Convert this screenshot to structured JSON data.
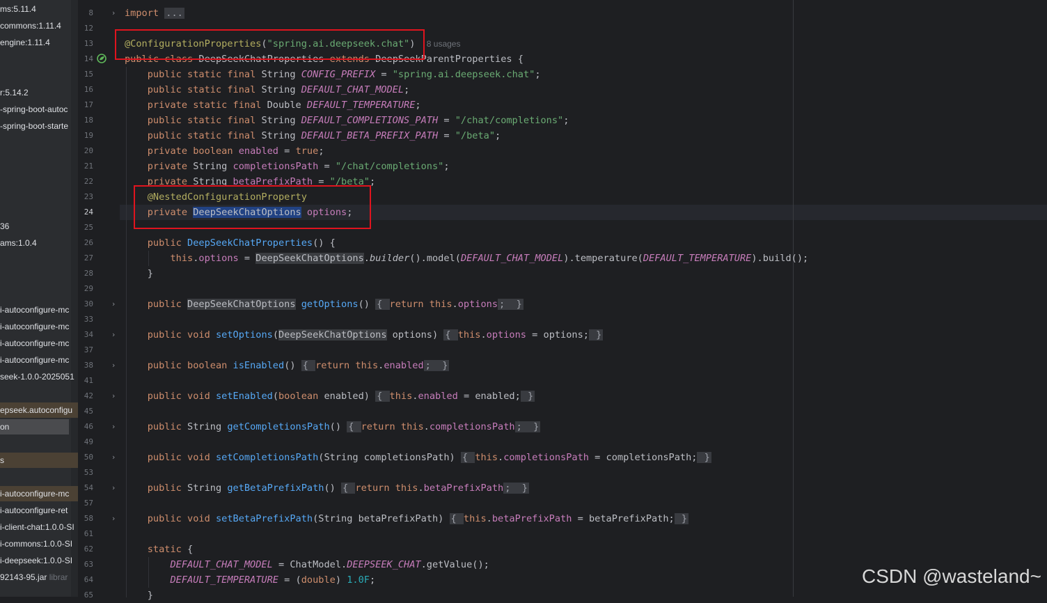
{
  "sidebar": {
    "items": [
      {
        "text": "ms:5.11.4"
      },
      {
        "text": "commons:1.11.4"
      },
      {
        "text": "engine:1.11.4"
      },
      {
        "text": "r:5.14.2"
      },
      {
        "text": "-spring-boot-autoc"
      },
      {
        "text": "-spring-boot-starte"
      },
      {
        "text": "36"
      },
      {
        "text": "ams:1.0.4"
      },
      {
        "text": "i-autoconfigure-mc"
      },
      {
        "text": "i-autoconfigure-mc"
      },
      {
        "text": "i-autoconfigure-mc"
      },
      {
        "text": "i-autoconfigure-mc"
      },
      {
        "text": "seek-1.0.0-2025051"
      },
      {
        "text": "epseek.autoconfigu"
      },
      {
        "text": "on"
      },
      {
        "text": "s"
      },
      {
        "text": "i-autoconfigure-mc"
      },
      {
        "text": "i-autoconfigure-ret"
      },
      {
        "text": "i-client-chat:1.0.0-SI"
      },
      {
        "text": "i-commons:1.0.0-SI"
      },
      {
        "text": "i-deepseek:1.0.0-SI"
      },
      {
        "text": "92143-95.jar",
        "dim": "librar"
      }
    ]
  },
  "editor": {
    "lines": [
      {
        "num": "8",
        "tokens": [
          [
            "kw",
            "import "
          ],
          [
            "fold-box",
            "..."
          ]
        ]
      },
      {
        "num": "12",
        "tokens": []
      },
      {
        "num": "13",
        "tokens": [
          [
            "ann",
            "@ConfigurationProperties"
          ],
          [
            "",
            "("
          ],
          [
            "str",
            "\"spring.ai.deepseek.chat\""
          ],
          [
            "",
            ")  "
          ],
          [
            "hint",
            "8 usages"
          ]
        ]
      },
      {
        "num": "14",
        "tokens": [
          [
            "kw",
            "public class "
          ],
          [
            "",
            "DeepSeekChatProperties "
          ],
          [
            "kw",
            "extends "
          ],
          [
            "",
            "DeepSeekParentProperties {"
          ]
        ]
      },
      {
        "num": "15",
        "tokens": [
          [
            "",
            "    "
          ],
          [
            "kw",
            "public static final "
          ],
          [
            "",
            "String "
          ],
          [
            "cst",
            "CONFIG_PREFIX"
          ],
          [
            "",
            " = "
          ],
          [
            "str",
            "\"spring.ai.deepseek.chat\""
          ],
          [
            "",
            ";"
          ]
        ]
      },
      {
        "num": "16",
        "tokens": [
          [
            "",
            "    "
          ],
          [
            "kw",
            "public static final "
          ],
          [
            "",
            "String "
          ],
          [
            "cst",
            "DEFAULT_CHAT_MODEL"
          ],
          [
            "",
            ";"
          ]
        ]
      },
      {
        "num": "17",
        "tokens": [
          [
            "",
            "    "
          ],
          [
            "kw",
            "private static final "
          ],
          [
            "",
            "Double "
          ],
          [
            "cst",
            "DEFAULT_TEMPERATURE"
          ],
          [
            "",
            ";"
          ]
        ]
      },
      {
        "num": "18",
        "tokens": [
          [
            "",
            "    "
          ],
          [
            "kw",
            "public static final "
          ],
          [
            "",
            "String "
          ],
          [
            "cst",
            "DEFAULT_COMPLETIONS_PATH"
          ],
          [
            "",
            " = "
          ],
          [
            "str",
            "\"/chat/completions\""
          ],
          [
            "",
            ";"
          ]
        ]
      },
      {
        "num": "19",
        "tokens": [
          [
            "",
            "    "
          ],
          [
            "kw",
            "public static final "
          ],
          [
            "",
            "String "
          ],
          [
            "cst",
            "DEFAULT_BETA_PREFIX_PATH"
          ],
          [
            "",
            " = "
          ],
          [
            "str",
            "\"/beta\""
          ],
          [
            "",
            ";"
          ]
        ]
      },
      {
        "num": "20",
        "tokens": [
          [
            "",
            "    "
          ],
          [
            "kw",
            "private boolean "
          ],
          [
            "fld",
            "enabled"
          ],
          [
            "",
            " = "
          ],
          [
            "kw",
            "true"
          ],
          [
            "",
            ";"
          ]
        ]
      },
      {
        "num": "21",
        "tokens": [
          [
            "",
            "    "
          ],
          [
            "kw",
            "private "
          ],
          [
            "",
            "String "
          ],
          [
            "fld",
            "completionsPath"
          ],
          [
            "",
            " = "
          ],
          [
            "str",
            "\"/chat/completions\""
          ],
          [
            "",
            ";"
          ]
        ]
      },
      {
        "num": "22",
        "tokens": [
          [
            "",
            "    "
          ],
          [
            "kw",
            "private "
          ],
          [
            "",
            "String "
          ],
          [
            "fld",
            "betaPrefixPath"
          ],
          [
            "",
            " = "
          ],
          [
            "str",
            "\"/beta\""
          ],
          [
            "",
            ";"
          ]
        ]
      },
      {
        "num": "23",
        "tokens": [
          [
            "",
            "    "
          ],
          [
            "ann",
            "@NestedConfigurationProperty"
          ]
        ]
      },
      {
        "num": "24",
        "tokens": [
          [
            "",
            "    "
          ],
          [
            "kw",
            "private "
          ],
          [
            "sel-bg",
            "DeepSeekChatOptions"
          ],
          [
            "",
            " "
          ],
          [
            "fld",
            "options"
          ],
          [
            "",
            ";"
          ]
        ]
      },
      {
        "num": "25",
        "tokens": []
      },
      {
        "num": "26",
        "tokens": [
          [
            "",
            "    "
          ],
          [
            "kw",
            "public "
          ],
          [
            "mth",
            "DeepSeekChatProperties"
          ],
          [
            "",
            "() {"
          ]
        ]
      },
      {
        "num": "27",
        "tokens": [
          [
            "",
            "        "
          ],
          [
            "kw",
            "this"
          ],
          [
            "",
            "."
          ],
          [
            "fld",
            "options"
          ],
          [
            "",
            " = "
          ],
          [
            "match",
            "DeepSeekChatOptions"
          ],
          [
            "",
            "."
          ],
          [
            "it",
            "builder"
          ],
          [
            "",
            "().model("
          ],
          [
            "cst",
            "DEFAULT_CHAT_MODEL"
          ],
          [
            "",
            ").temperature("
          ],
          [
            "cst",
            "DEFAULT_TEMPERATURE"
          ],
          [
            "",
            ").build();"
          ]
        ]
      },
      {
        "num": "28",
        "tokens": [
          [
            "",
            "    }"
          ]
        ]
      },
      {
        "num": "29",
        "tokens": []
      },
      {
        "num": "30",
        "tokens": [
          [
            "",
            "    "
          ],
          [
            "kw",
            "public "
          ],
          [
            "match",
            "DeepSeekChatOptions"
          ],
          [
            "",
            " "
          ],
          [
            "mth",
            "getOptions"
          ],
          [
            "",
            "() "
          ],
          [
            "fold-box",
            "{ "
          ],
          [
            "kw",
            "return this"
          ],
          [
            "",
            "."
          ],
          [
            "fld",
            "options"
          ],
          [
            "fold-box",
            ";  }"
          ]
        ]
      },
      {
        "num": "33",
        "tokens": []
      },
      {
        "num": "34",
        "tokens": [
          [
            "",
            "    "
          ],
          [
            "kw",
            "public void "
          ],
          [
            "mth",
            "setOptions"
          ],
          [
            "",
            "("
          ],
          [
            "match",
            "DeepSeekChatOptions"
          ],
          [
            "",
            " options) "
          ],
          [
            "fold-box",
            "{ "
          ],
          [
            "kw",
            "this"
          ],
          [
            "",
            "."
          ],
          [
            "fld",
            "options"
          ],
          [
            "",
            " = options;"
          ],
          [
            "fold-box",
            " }"
          ]
        ]
      },
      {
        "num": "37",
        "tokens": []
      },
      {
        "num": "38",
        "tokens": [
          [
            "",
            "    "
          ],
          [
            "kw",
            "public boolean "
          ],
          [
            "mth",
            "isEnabled"
          ],
          [
            "",
            "() "
          ],
          [
            "fold-box",
            "{ "
          ],
          [
            "kw",
            "return this"
          ],
          [
            "",
            "."
          ],
          [
            "fld",
            "enabled"
          ],
          [
            "fold-box",
            ";  }"
          ]
        ]
      },
      {
        "num": "41",
        "tokens": []
      },
      {
        "num": "42",
        "tokens": [
          [
            "",
            "    "
          ],
          [
            "kw",
            "public void "
          ],
          [
            "mth",
            "setEnabled"
          ],
          [
            "",
            "("
          ],
          [
            "kw",
            "boolean "
          ],
          [
            "",
            "enabled) "
          ],
          [
            "fold-box",
            "{ "
          ],
          [
            "kw",
            "this"
          ],
          [
            "",
            "."
          ],
          [
            "fld",
            "enabled"
          ],
          [
            "",
            " = enabled;"
          ],
          [
            "fold-box",
            " }"
          ]
        ]
      },
      {
        "num": "45",
        "tokens": []
      },
      {
        "num": "46",
        "tokens": [
          [
            "",
            "    "
          ],
          [
            "kw",
            "public "
          ],
          [
            "",
            "String "
          ],
          [
            "mth",
            "getCompletionsPath"
          ],
          [
            "",
            "() "
          ],
          [
            "fold-box",
            "{ "
          ],
          [
            "kw",
            "return this"
          ],
          [
            "",
            "."
          ],
          [
            "fld",
            "completionsPath"
          ],
          [
            "fold-box",
            ";  }"
          ]
        ]
      },
      {
        "num": "49",
        "tokens": []
      },
      {
        "num": "50",
        "tokens": [
          [
            "",
            "    "
          ],
          [
            "kw",
            "public void "
          ],
          [
            "mth",
            "setCompletionsPath"
          ],
          [
            "",
            "(String completionsPath) "
          ],
          [
            "fold-box",
            "{ "
          ],
          [
            "kw",
            "this"
          ],
          [
            "",
            "."
          ],
          [
            "fld",
            "completionsPath"
          ],
          [
            "",
            " = completionsPath;"
          ],
          [
            "fold-box",
            " }"
          ]
        ]
      },
      {
        "num": "53",
        "tokens": []
      },
      {
        "num": "54",
        "tokens": [
          [
            "",
            "    "
          ],
          [
            "kw",
            "public "
          ],
          [
            "",
            "String "
          ],
          [
            "mth",
            "getBetaPrefixPath"
          ],
          [
            "",
            "() "
          ],
          [
            "fold-box",
            "{ "
          ],
          [
            "kw",
            "return this"
          ],
          [
            "",
            "."
          ],
          [
            "fld",
            "betaPrefixPath"
          ],
          [
            "fold-box",
            ";  }"
          ]
        ]
      },
      {
        "num": "57",
        "tokens": []
      },
      {
        "num": "58",
        "tokens": [
          [
            "",
            "    "
          ],
          [
            "kw",
            "public void "
          ],
          [
            "mth",
            "setBetaPrefixPath"
          ],
          [
            "",
            "(String betaPrefixPath) "
          ],
          [
            "fold-box",
            "{ "
          ],
          [
            "kw",
            "this"
          ],
          [
            "",
            "."
          ],
          [
            "fld",
            "betaPrefixPath"
          ],
          [
            "",
            " = betaPrefixPath;"
          ],
          [
            "fold-box",
            " }"
          ]
        ]
      },
      {
        "num": "61",
        "tokens": []
      },
      {
        "num": "62",
        "tokens": [
          [
            "",
            "    "
          ],
          [
            "kw",
            "static "
          ],
          [
            "",
            "{"
          ]
        ]
      },
      {
        "num": "63",
        "tokens": [
          [
            "",
            "        "
          ],
          [
            "cst",
            "DEFAULT_CHAT_MODEL"
          ],
          [
            "",
            " = ChatModel."
          ],
          [
            "cst",
            "DEEPSEEK_CHAT"
          ],
          [
            "",
            ".getValue();"
          ]
        ]
      },
      {
        "num": "64",
        "tokens": [
          [
            "",
            "        "
          ],
          [
            "cst",
            "DEFAULT_TEMPERATURE"
          ],
          [
            "",
            " = ("
          ],
          [
            "kw",
            "double"
          ],
          [
            "",
            ") "
          ],
          [
            "num",
            "1.0F"
          ],
          [
            "",
            ";"
          ]
        ]
      },
      {
        "num": "65",
        "tokens": [
          [
            "",
            "    }"
          ]
        ]
      }
    ]
  },
  "colors": {
    "highlight_box": "#e0141e",
    "keyword": "#cf8e6d",
    "string": "#6aab73",
    "annotation": "#b3ae60",
    "constant": "#c77dbb",
    "method": "#56a8f5"
  },
  "watermark": "CSDN @wasteland~"
}
